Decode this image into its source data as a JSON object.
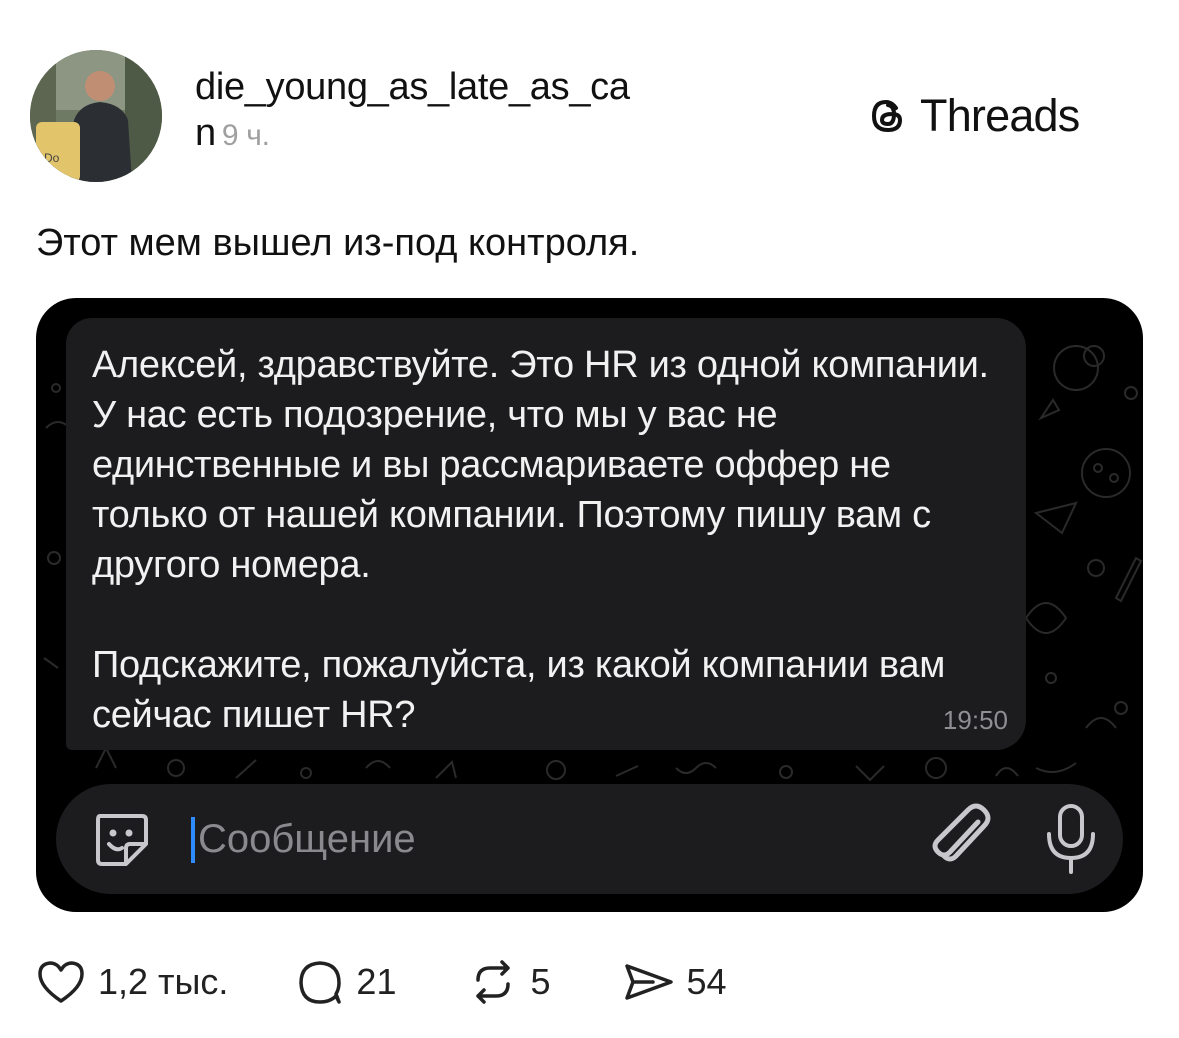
{
  "post": {
    "username_line1": "die_young_as_late_as_ca",
    "username_line2": "n",
    "time": "9 ч.",
    "text": "Этот мем вышел из-под контроля."
  },
  "brand": {
    "name": "Threads"
  },
  "chat": {
    "message_p1": "Алексей, здравствуйте. Это HR из одной компании. У нас есть подозрение, что мы у вас не единственные и вы рассмариваете оффер не только от нашей компании. Поэтому пишу вам с другого номера.",
    "message_p2": "Подскажите, пожалуйста, из какой компании вам сейчас пишет HR?",
    "time": "19:50",
    "input_placeholder": "Сообщение",
    "icons": [
      "sticker-icon",
      "paperclip-icon",
      "microphone-icon"
    ]
  },
  "actions": {
    "likes": "1,2 тыс.",
    "comments": "21",
    "reposts": "5",
    "shares": "54"
  },
  "colors": {
    "chat_bg": "#000000",
    "bubble": "#1c1c1e",
    "cursor": "#2f8cff",
    "timestamp": "#8e8e93"
  }
}
